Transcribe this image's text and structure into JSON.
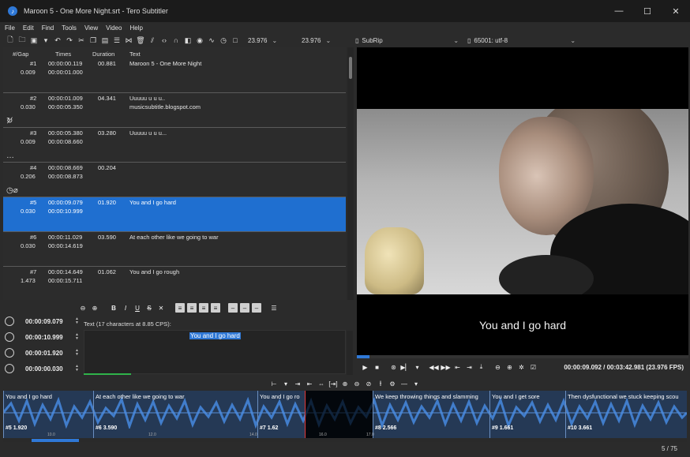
{
  "window": {
    "title": "Maroon 5 - One More Night.srt - Tero Subtitler",
    "min_icon": "minimize-icon",
    "max_icon": "maximize-icon",
    "close_icon": "close-icon"
  },
  "menu": [
    "File",
    "Edit",
    "Find",
    "Tools",
    "View",
    "Video",
    "Help"
  ],
  "toolbar": {
    "icons": [
      "new-file-icon",
      "open-file-icon",
      "save-icon",
      "undo-icon",
      "redo-icon",
      "cut-icon",
      "copy-icon",
      "paste-icon",
      "list-icon",
      "merge-icon",
      "delete-icon",
      "split-icon",
      "code-icon",
      "headphones-icon",
      "contrast-icon",
      "target-icon",
      "wave-icon",
      "timer-icon",
      "stop-icon"
    ],
    "fps1": "23.976",
    "fps2": "23.976",
    "format": "SubRip",
    "encoding": "65001: utf-8"
  },
  "list": {
    "headers": {
      "num_gap": "#/Gap",
      "times": "Times",
      "duration": "Duration",
      "text": "Text"
    },
    "rows": [
      {
        "num": "#1",
        "gap": "0.009",
        "start": "00:00:00.119",
        "end": "00:00:01.000",
        "duration": "00.881",
        "text1": "Maroon 5 - One More Night",
        "text2": ""
      },
      {
        "num": "#2",
        "gap": "0.030",
        "start": "00:00:01.009",
        "end": "00:00:05.350",
        "duration": "04.341",
        "text1": "Uuuuu u u u..",
        "text2": "musicsubtitle.blogspot.com"
      },
      {
        "num": "#3",
        "gap": "0.009",
        "start": "00:00:05.380",
        "end": "00:00:08.660",
        "duration": "03.280",
        "text1": "Uuuuu u u u...",
        "text2": ""
      },
      {
        "num": "#4",
        "gap": "0.206",
        "start": "00:00:08.669",
        "end": "00:00:08.873",
        "duration": "00.204",
        "text1": "",
        "text2": ""
      },
      {
        "num": "#5",
        "gap": "0.030",
        "start": "00:00:09.079",
        "end": "00:00:10.999",
        "duration": "01.920",
        "text1": "You and I go hard",
        "text2": ""
      },
      {
        "num": "#6",
        "gap": "0.030",
        "start": "00:00:11.029",
        "end": "00:00:14.619",
        "duration": "03.590",
        "text1": "At each other like we going to war",
        "text2": ""
      },
      {
        "num": "#7",
        "gap": "1.473",
        "start": "00:00:14.649",
        "end": "00:00:15.711",
        "duration": "01.062",
        "text1": "You and I go rough",
        "text2": ""
      }
    ]
  },
  "row_icons": {
    "r2": "↻̸",
    "r3": "…",
    "r4": "◷⌀"
  },
  "format_bar": [
    "prev-icon",
    "next-icon",
    "B",
    "I",
    "U",
    "S",
    "clear-icon",
    "align-left-icon",
    "align-center-icon",
    "align-right-icon",
    "align-justify-icon",
    "minus1-icon",
    "minus2-icon",
    "minus3-icon",
    "menu-icon"
  ],
  "fields": {
    "start": "00:00:09.079",
    "end": "00:00:10.999",
    "duration": "00:00:01.920",
    "gap": "00:00:00.030"
  },
  "editor": {
    "label": "Text (17 characters at 8.85 CPS):",
    "text": "You and I go hard"
  },
  "video": {
    "subtitle": "You and I go hard",
    "time": "00:00:09.092 / 00:03:42.981 (23.976 FPS)"
  },
  "waveform": {
    "segments": [
      {
        "text": "You and I go hard",
        "num": "#5  1.920"
      },
      {
        "text": "At each other like we going to war",
        "num": "#6  3.590"
      },
      {
        "text": "You and I go ro",
        "num": "#7  1.62"
      },
      {
        "text": "",
        "num": ""
      },
      {
        "text": "We keep throwing things and slamming",
        "num": "#8  2.566"
      },
      {
        "text": "You and I get sore",
        "num": "#9  1.661"
      },
      {
        "text": "Then dysfunctional we stuck keeping scou",
        "num": "#10  3.661"
      }
    ],
    "ticks": [
      "10.0",
      "12.0",
      "14.0",
      "16.0",
      "17.0"
    ]
  },
  "status": {
    "page": "5 / 75"
  },
  "colors": {
    "accent": "#1f6fd0",
    "green": "#2fb34a",
    "playhead": "#e23b3b"
  }
}
